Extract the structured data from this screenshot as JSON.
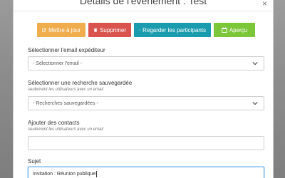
{
  "dialog": {
    "title": "Détails de l'évènement : Test",
    "close_symbol": "×"
  },
  "actions": [
    {
      "label": "Mettre à jour",
      "icon": "edit-icon",
      "color": "#f0ad4e"
    },
    {
      "label": "Supprimer",
      "icon": "trash-icon",
      "color": "#d9534f"
    },
    {
      "label": "Regarder les participants",
      "icon": "eye-icon",
      "color": "#1a9cae"
    },
    {
      "label": "Aperçu",
      "icon": "calendar-icon",
      "color": "#7cc63a"
    }
  ],
  "form": {
    "sender": {
      "label": "Sélectionner l'email expéditeur",
      "value": "- Sélectionner l'email -"
    },
    "saved_search": {
      "label": "Sélectionner une recherche sauvegardée",
      "hint": "seulement les utilisateurs avec un email",
      "value": "- Recherches sauvegardées -"
    },
    "contacts": {
      "label": "Ajouter des contacts",
      "hint": "seulement les utilisateurs avec un email",
      "value": ""
    },
    "subject": {
      "label": "Sujet",
      "value": "Invitation : Réunion publique"
    }
  }
}
